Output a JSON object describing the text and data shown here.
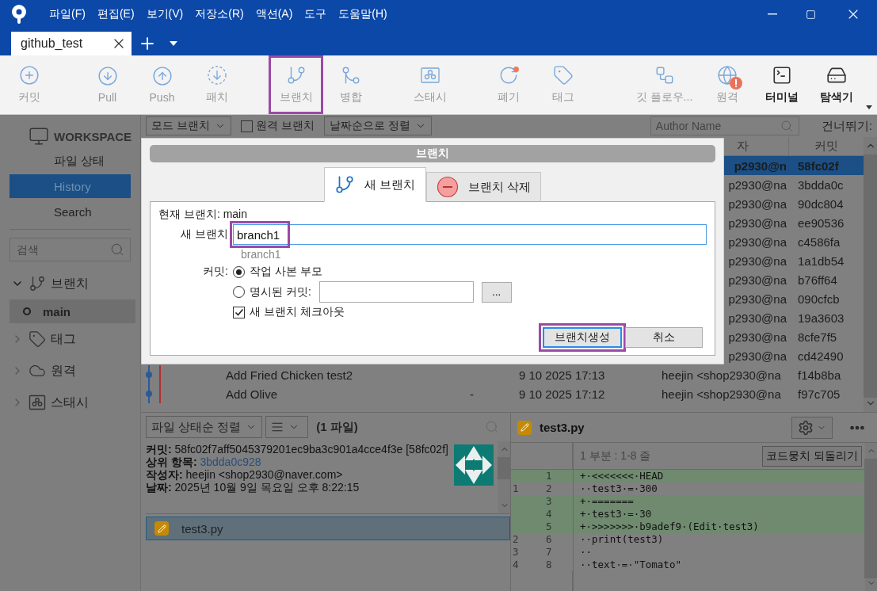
{
  "window": {
    "menus": [
      "파일(F)",
      "편집(E)",
      "보기(V)",
      "저장소(R)",
      "액션(A)",
      "도구",
      "도움말(H)"
    ]
  },
  "tabs": [
    {
      "label": "github_test",
      "selected": true
    }
  ],
  "toolbar": [
    {
      "label": "커밋",
      "kind": "commit",
      "enabled": false,
      "annotated": false
    },
    {
      "label": "Pull",
      "kind": "pull",
      "enabled": false,
      "annotated": false
    },
    {
      "label": "Push",
      "kind": "push",
      "enabled": false,
      "annotated": false
    },
    {
      "label": "패치",
      "kind": "patch",
      "enabled": false,
      "annotated": false
    },
    {
      "label": "브랜치",
      "kind": "branch",
      "enabled": false,
      "annotated": true
    },
    {
      "label": "병합",
      "kind": "merge",
      "enabled": false,
      "annotated": false
    },
    {
      "label": "스태시",
      "kind": "stash",
      "enabled": false,
      "annotated": false
    },
    {
      "label": "폐기",
      "kind": "discard",
      "enabled": false,
      "annotated": false
    },
    {
      "label": "태그",
      "kind": "tag",
      "enabled": false,
      "annotated": false
    },
    {
      "label": "깃 플로우...",
      "kind": "flow",
      "enabled": false,
      "annotated": false
    },
    {
      "label": "원격",
      "kind": "remote",
      "enabled": false,
      "annotated": false
    },
    {
      "label": "터미널",
      "kind": "terminal",
      "enabled": true,
      "annotated": false
    },
    {
      "label": "탐색기",
      "kind": "explorer",
      "enabled": true,
      "annotated": false
    }
  ],
  "sidebar": {
    "workspace_title": "WORKSPACE",
    "items": [
      {
        "label": "파일 상태",
        "selected": false
      },
      {
        "label": "History",
        "selected": true
      },
      {
        "label": "Search",
        "selected": false
      }
    ],
    "search": {
      "placeholder": "검색"
    },
    "tree": [
      {
        "label": "브랜치",
        "kind": "branch",
        "expanded": true,
        "children": [
          {
            "label": "main",
            "selected": true
          }
        ]
      },
      {
        "label": "태그",
        "kind": "tag",
        "expanded": false
      },
      {
        "label": "원격",
        "kind": "remote",
        "expanded": false
      },
      {
        "label": "스태시",
        "kind": "stash",
        "expanded": false
      }
    ]
  },
  "filter_bar": {
    "branch_filter": "모드 브랜치",
    "remote_branches": {
      "label": "원격 브랜치",
      "checked": false
    },
    "sort": "날짜순으로 정렬",
    "author_search": {
      "placeholder": "Author Name"
    },
    "skip_label": "건너뛰기:"
  },
  "history": {
    "columns": {
      "author": "자",
      "commit": "커밋"
    },
    "rows": [
      {
        "kind": "partial",
        "author": "p2930@n",
        "commit": "58fc02f",
        "selected": true
      },
      {
        "kind": "partial",
        "author": "p2930@na",
        "commit": "3bdda0c",
        "selected": false
      },
      {
        "kind": "partial",
        "author": "p2930@na",
        "commit": "90dc804",
        "selected": false
      },
      {
        "kind": "partial",
        "author": "p2930@na",
        "commit": "ee90536",
        "selected": false
      },
      {
        "kind": "partial",
        "author": "p2930@na",
        "commit": "c4586fa",
        "selected": false
      },
      {
        "kind": "partial",
        "author": "p2930@na",
        "commit": "1a1db54",
        "selected": false
      },
      {
        "kind": "partial",
        "author": "p2930@na",
        "commit": "b76ff64",
        "selected": false
      },
      {
        "kind": "partial",
        "author": "p2930@na",
        "commit": "090cfcb",
        "selected": false
      },
      {
        "kind": "partial",
        "author": "p2930@na",
        "commit": "19a3603",
        "selected": false
      },
      {
        "kind": "partial",
        "author": "p2930@na",
        "commit": "8cfe7f5",
        "selected": false
      },
      {
        "kind": "partial",
        "author": "p2930@na",
        "commit": "cd42490",
        "selected": false
      },
      {
        "kind": "full",
        "description": "Add Fried Chicken test2",
        "date": "9 10 2025 17:13",
        "author": "heejin <shop2930@na",
        "commit": "f14b8ba",
        "selected": false
      },
      {
        "kind": "full",
        "description": "Add Olive",
        "column_3": "-",
        "date": "9 10 2025 17:12",
        "author": "heejin <shop2930@na",
        "commit": "f97c705",
        "selected": false
      }
    ]
  },
  "file_panel": {
    "sort": "파일 상태순 정렬",
    "file_count": "(1 파일)",
    "commit_info": [
      {
        "kind": "text",
        "text": "**커밋:** 58fc02f7aff5045379201ec9ba3c901a4cce4f3e [58fc02f]"
      },
      {
        "kind": "link",
        "label": "상위 항목:",
        "value": "3bdda0c928"
      },
      {
        "kind": "text",
        "text": "**작성자:** heejin <shop2930@naver.com>"
      },
      {
        "kind": "text",
        "text": "**날짜:** 2025년 10월 9일 목요일 오후 8:22:15"
      }
    ],
    "files": [
      {
        "name": "test3.py",
        "selected": true
      }
    ]
  },
  "diff": {
    "file": "test3.py",
    "hunk": "1 부분 : 1-8 줄",
    "revert_button": "코드뭉치 되돌리기",
    "lines": [
      {
        "kind": "added",
        "new": "1",
        "text": "+·<<<<<<<·HEAD"
      },
      {
        "kind": "context",
        "old": "1",
        "new": "2",
        "text": "··test3·=·300"
      },
      {
        "kind": "added",
        "new": "3",
        "text": "+·======="
      },
      {
        "kind": "added",
        "new": "4",
        "text": "+·test3·=·30"
      },
      {
        "kind": "added",
        "new": "5",
        "text": "+·>>>>>>>·b9adef9·(Edit·test3)"
      },
      {
        "kind": "context",
        "old": "2",
        "new": "6",
        "text": "··print(test3)"
      },
      {
        "kind": "context",
        "old": "3",
        "new": "7",
        "text": "··"
      },
      {
        "kind": "context",
        "old": "4",
        "new": "8",
        "text": "··text·=·\"Tomato\""
      }
    ]
  },
  "dialog": {
    "title": "브랜치",
    "tabs": [
      {
        "label": "새 브랜치",
        "kind": "new",
        "selected": true
      },
      {
        "label": "브랜치 삭제",
        "kind": "delete",
        "selected": false
      }
    ],
    "current_branch": {
      "label": "현재 브랜치:",
      "value": "main"
    },
    "new_branch": {
      "label": "새 브랜치",
      "value": "branch1",
      "annotated": true
    },
    "preview": "branch1",
    "commit_label": "커밋:",
    "commit_options": [
      {
        "label": "작업 사본 부모",
        "selected": true
      },
      {
        "label": "명시된 커밋:",
        "selected": false
      }
    ],
    "browse_button": "...",
    "checkout": {
      "label": "새 브랜치 체크아웃",
      "checked": true
    },
    "buttons": [
      {
        "label": "브랜치생성",
        "kind": "primary",
        "annotated": true
      },
      {
        "label": "취소",
        "kind": "secondary",
        "annotated": false
      }
    ]
  }
}
